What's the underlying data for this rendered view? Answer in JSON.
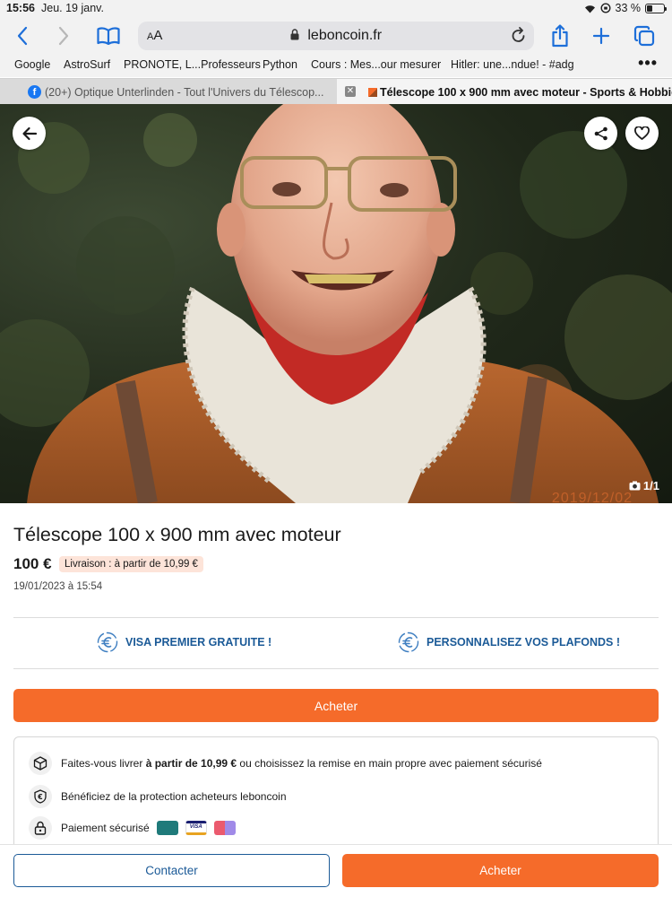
{
  "status_bar": {
    "time": "15:56",
    "date": "Jeu. 19 janv.",
    "battery": "33 %",
    "battery_level": 0.33
  },
  "browser": {
    "aa_label": "AA",
    "url": "leboncoin.fr",
    "bookmarks": [
      "Google",
      "AstroSurf",
      "PRONOTE, L...Professeurs",
      "Python",
      "Cours : Mes...our mesurer",
      "Hitler: une...ndue! - #adg"
    ],
    "more": "•••",
    "tabs": [
      {
        "label": "(20+) Optique Unterlinden - Tout l'Univers du Télescop...",
        "active": false,
        "icon": "facebook-icon"
      },
      {
        "label": "Télescope 100 x 900 mm avec moteur - Sports & Hobbies",
        "active": true,
        "icon": "leboncoin-icon"
      }
    ]
  },
  "photo": {
    "counter": "1/1",
    "date_stamp": "2019/12/02"
  },
  "listing": {
    "title": "Télescope 100 x 900 mm avec moteur",
    "price": "100 €",
    "delivery": "Livraison : à partir de 10,99 €",
    "posted": "19/01/2023 à 15:54"
  },
  "promos": [
    {
      "label": "VISA PREMIER GRATUITE !",
      "icon": "euro-icon"
    },
    {
      "label": "PERSONNALISEZ VOS PLAFONDS !",
      "icon": "euro-icon"
    }
  ],
  "buy_button": "Acheter",
  "features": {
    "delivery_pre": "Faites-vous livrer ",
    "delivery_bold": "à partir de 10,99 €",
    "delivery_post": " ou choisissez la remise en main propre avec paiement sécurisé",
    "protection": "Bénéficiez de la protection acheteurs leboncoin",
    "payment": "Paiement sécurisé",
    "card_visa": "VISA"
  },
  "bottom_bar": {
    "contact": "Contacter",
    "buy": "Acheter"
  },
  "colors": {
    "accent": "#f56b2a",
    "link": "#1b5a97",
    "safari_blue": "#1e6fd9"
  }
}
